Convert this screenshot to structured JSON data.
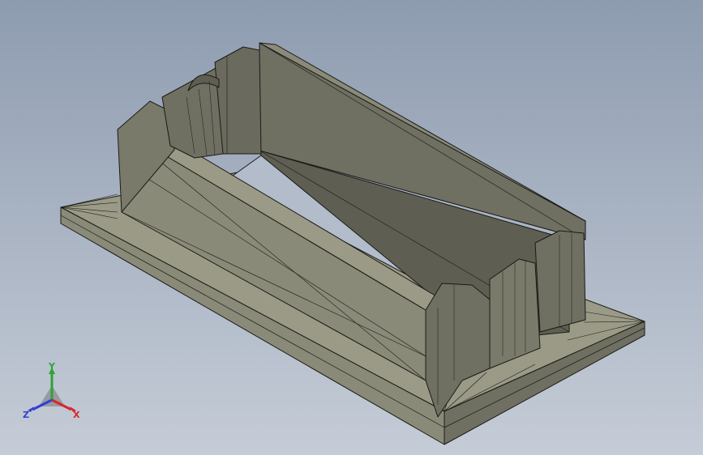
{
  "viewport": {
    "background_top": "#8e9cb0",
    "background_bottom": "#c5ccd7"
  },
  "model": {
    "shade_dark": "#5e5e52",
    "shade_mid": "#6f6f62",
    "shade_light": "#8a8a79",
    "shade_top": "#9a9a87",
    "edge_color": "#1b1b16"
  },
  "triad": {
    "x_label": "X",
    "y_label": "Y",
    "z_label": "Z",
    "x_color": "#d8262b",
    "y_color": "#2ea336",
    "z_color": "#2f3fd1"
  }
}
